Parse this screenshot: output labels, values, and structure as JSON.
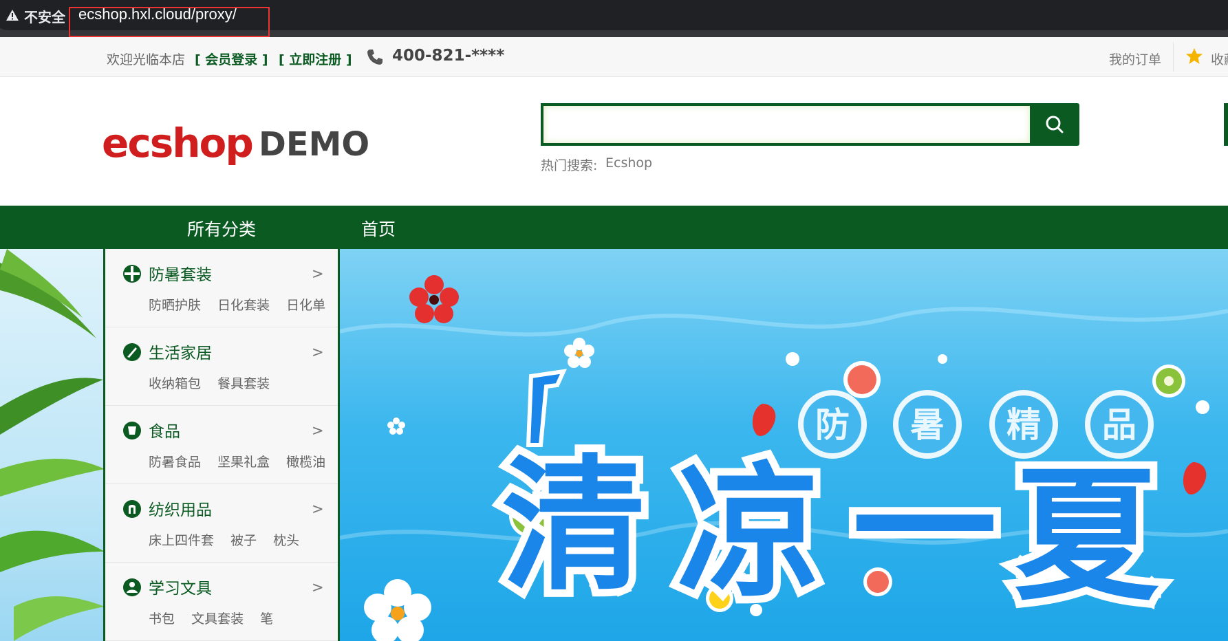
{
  "browser": {
    "security_label": "不安全",
    "url": "ecshop.hxl.cloud/proxy/"
  },
  "topbar": {
    "welcome": "欢迎光临本店",
    "login": "[ 会员登录 ]",
    "register": "[ 立即注册 ]",
    "phone": "400-821-****",
    "my_orders": "我的订单",
    "favorites": "收藏"
  },
  "header": {
    "logo_text": "ecshop",
    "logo_demo": "DEMO",
    "search_placeholder": "",
    "hot_label": "热门搜索:",
    "hot_keyword": "Ecshop"
  },
  "nav": {
    "all_categories": "所有分类",
    "home": "首页"
  },
  "categories": [
    {
      "title": "防暑套装",
      "icon": "globe-icon",
      "subs": [
        "防晒护肤",
        "日化套装",
        "日化单"
      ]
    },
    {
      "title": "生活家居",
      "icon": "leaf-icon",
      "subs": [
        "收纳箱包",
        "餐具套装"
      ]
    },
    {
      "title": "食品",
      "icon": "cup-icon",
      "subs": [
        "防暑食品",
        "坚果礼盒",
        "橄榄油"
      ]
    },
    {
      "title": "纺织用品",
      "icon": "textile-icon",
      "subs": [
        "床上四件套",
        "被子",
        "枕头"
      ]
    },
    {
      "title": "学习文具",
      "icon": "people-icon",
      "subs": [
        "书包",
        "文具套装",
        "笔"
      ]
    }
  ],
  "banner": {
    "main_text": [
      "清",
      "凉",
      "一",
      "夏"
    ],
    "bubble_text": [
      "防",
      "暑",
      "精",
      "品"
    ]
  },
  "colors": {
    "brand_green": "#0a5a22",
    "logo_red": "#d01e1e",
    "banner_blue": "#1a86ea"
  }
}
